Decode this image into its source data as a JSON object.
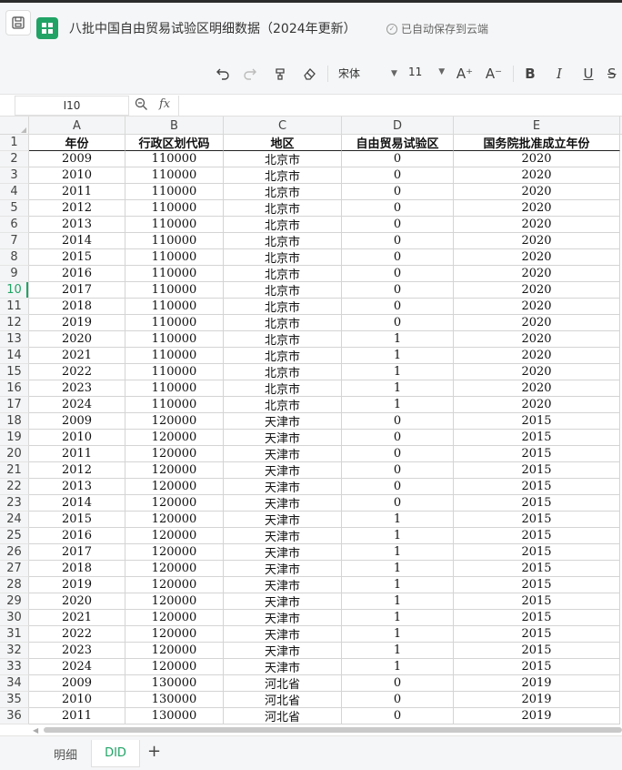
{
  "window": {
    "title": "八批中国自由贸易试验区明细数据（2024年更新）",
    "save_status": "已自动保存到云端"
  },
  "toolbar": {
    "font_name": "宋体",
    "font_size": "11",
    "items": [
      "undo-icon",
      "redo-icon",
      "format-painter-icon",
      "eraser-icon",
      "increase-font-icon",
      "decrease-font-icon",
      "bold-icon",
      "italic-icon",
      "underline-icon",
      "strikethrough-icon"
    ],
    "increase_font_label": "A⁺",
    "decrease_font_label": "A⁻",
    "bold_label": "B",
    "italic_label": "I",
    "underline_label": "U",
    "strike_label": "S"
  },
  "formula_bar": {
    "cell_ref": "I10",
    "fx_label": "fx",
    "value": ""
  },
  "columns": [
    "A",
    "B",
    "C",
    "D",
    "E"
  ],
  "header_row": {
    "number": "1",
    "cells": [
      "年份",
      "行政区划代码",
      "地区",
      "自由贸易试验区",
      "国务院批准成立年份"
    ]
  },
  "active_row": "10",
  "rows": [
    {
      "n": "2",
      "c": [
        "2009",
        "110000",
        "北京市",
        "0",
        "2020"
      ]
    },
    {
      "n": "3",
      "c": [
        "2010",
        "110000",
        "北京市",
        "0",
        "2020"
      ]
    },
    {
      "n": "4",
      "c": [
        "2011",
        "110000",
        "北京市",
        "0",
        "2020"
      ]
    },
    {
      "n": "5",
      "c": [
        "2012",
        "110000",
        "北京市",
        "0",
        "2020"
      ]
    },
    {
      "n": "6",
      "c": [
        "2013",
        "110000",
        "北京市",
        "0",
        "2020"
      ]
    },
    {
      "n": "7",
      "c": [
        "2014",
        "110000",
        "北京市",
        "0",
        "2020"
      ]
    },
    {
      "n": "8",
      "c": [
        "2015",
        "110000",
        "北京市",
        "0",
        "2020"
      ]
    },
    {
      "n": "9",
      "c": [
        "2016",
        "110000",
        "北京市",
        "0",
        "2020"
      ]
    },
    {
      "n": "10",
      "c": [
        "2017",
        "110000",
        "北京市",
        "0",
        "2020"
      ]
    },
    {
      "n": "11",
      "c": [
        "2018",
        "110000",
        "北京市",
        "0",
        "2020"
      ]
    },
    {
      "n": "12",
      "c": [
        "2019",
        "110000",
        "北京市",
        "0",
        "2020"
      ]
    },
    {
      "n": "13",
      "c": [
        "2020",
        "110000",
        "北京市",
        "1",
        "2020"
      ]
    },
    {
      "n": "14",
      "c": [
        "2021",
        "110000",
        "北京市",
        "1",
        "2020"
      ]
    },
    {
      "n": "15",
      "c": [
        "2022",
        "110000",
        "北京市",
        "1",
        "2020"
      ]
    },
    {
      "n": "16",
      "c": [
        "2023",
        "110000",
        "北京市",
        "1",
        "2020"
      ]
    },
    {
      "n": "17",
      "c": [
        "2024",
        "110000",
        "北京市",
        "1",
        "2020"
      ]
    },
    {
      "n": "18",
      "c": [
        "2009",
        "120000",
        "天津市",
        "0",
        "2015"
      ]
    },
    {
      "n": "19",
      "c": [
        "2010",
        "120000",
        "天津市",
        "0",
        "2015"
      ]
    },
    {
      "n": "20",
      "c": [
        "2011",
        "120000",
        "天津市",
        "0",
        "2015"
      ]
    },
    {
      "n": "21",
      "c": [
        "2012",
        "120000",
        "天津市",
        "0",
        "2015"
      ]
    },
    {
      "n": "22",
      "c": [
        "2013",
        "120000",
        "天津市",
        "0",
        "2015"
      ]
    },
    {
      "n": "23",
      "c": [
        "2014",
        "120000",
        "天津市",
        "0",
        "2015"
      ]
    },
    {
      "n": "24",
      "c": [
        "2015",
        "120000",
        "天津市",
        "1",
        "2015"
      ]
    },
    {
      "n": "25",
      "c": [
        "2016",
        "120000",
        "天津市",
        "1",
        "2015"
      ]
    },
    {
      "n": "26",
      "c": [
        "2017",
        "120000",
        "天津市",
        "1",
        "2015"
      ]
    },
    {
      "n": "27",
      "c": [
        "2018",
        "120000",
        "天津市",
        "1",
        "2015"
      ]
    },
    {
      "n": "28",
      "c": [
        "2019",
        "120000",
        "天津市",
        "1",
        "2015"
      ]
    },
    {
      "n": "29",
      "c": [
        "2020",
        "120000",
        "天津市",
        "1",
        "2015"
      ]
    },
    {
      "n": "30",
      "c": [
        "2021",
        "120000",
        "天津市",
        "1",
        "2015"
      ]
    },
    {
      "n": "31",
      "c": [
        "2022",
        "120000",
        "天津市",
        "1",
        "2015"
      ]
    },
    {
      "n": "32",
      "c": [
        "2023",
        "120000",
        "天津市",
        "1",
        "2015"
      ]
    },
    {
      "n": "33",
      "c": [
        "2024",
        "120000",
        "天津市",
        "1",
        "2015"
      ]
    },
    {
      "n": "34",
      "c": [
        "2009",
        "130000",
        "河北省",
        "0",
        "2019"
      ]
    },
    {
      "n": "35",
      "c": [
        "2010",
        "130000",
        "河北省",
        "0",
        "2019"
      ]
    },
    {
      "n": "36",
      "c": [
        "2011",
        "130000",
        "河北省",
        "0",
        "2019"
      ]
    }
  ],
  "sheets": {
    "tabs": [
      "明细",
      "DID"
    ],
    "active_index": 1,
    "add_label": "+"
  },
  "colors": {
    "accent": "#21a366",
    "header_bg": "#f4f5f6"
  }
}
